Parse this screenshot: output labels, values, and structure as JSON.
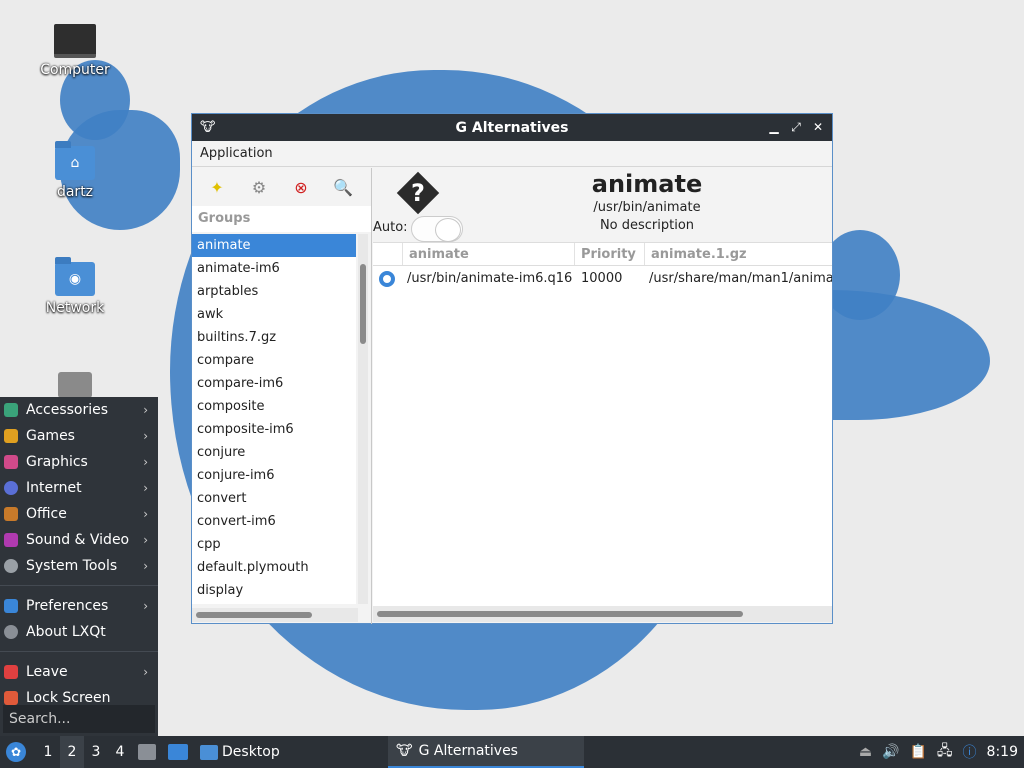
{
  "desktop": {
    "icons": [
      {
        "label": "Computer",
        "icon": "computer-icon"
      },
      {
        "label": "dartz",
        "icon": "home-folder-icon"
      },
      {
        "label": "Network",
        "icon": "network-folder-icon"
      }
    ]
  },
  "window": {
    "title": "G Alternatives",
    "menu": {
      "application": "Application"
    },
    "toolbar": [
      "new-icon",
      "properties-icon",
      "delete-icon",
      "search-icon"
    ],
    "groups_header": "Groups",
    "groups": [
      "animate",
      "animate-im6",
      "arptables",
      "awk",
      "builtins.7.gz",
      "compare",
      "compare-im6",
      "composite",
      "composite-im6",
      "conjure",
      "conjure-im6",
      "convert",
      "convert-im6",
      "cpp",
      "default.plymouth",
      "display"
    ],
    "selected_group": "animate",
    "detail": {
      "name": "animate",
      "path": "/usr/bin/animate",
      "description": "No description",
      "auto_label": "Auto:",
      "auto_enabled": false,
      "columns": [
        "animate",
        "Priority",
        "animate.1.gz"
      ],
      "rows": [
        {
          "selected": true,
          "path": "/usr/bin/animate-im6.q16",
          "priority": "10000",
          "slave": "/usr/share/man/man1/anima"
        }
      ]
    }
  },
  "start_menu": {
    "items": [
      {
        "label": "Accessories",
        "submenu": true,
        "color": "#3aa37a"
      },
      {
        "label": "Games",
        "submenu": true,
        "color": "#e0a020"
      },
      {
        "label": "Graphics",
        "submenu": true,
        "color": "#d04a8a"
      },
      {
        "label": "Internet",
        "submenu": true,
        "color": "#5a6fd6"
      },
      {
        "label": "Office",
        "submenu": true,
        "color": "#c87a2a"
      },
      {
        "label": "Sound & Video",
        "submenu": true,
        "color": "#b03ab0"
      },
      {
        "label": "System Tools",
        "submenu": true,
        "color": "#9aa0a6"
      }
    ],
    "items2": [
      {
        "label": "Preferences",
        "submenu": true,
        "color": "#3a86d8"
      },
      {
        "label": "About LXQt",
        "submenu": false,
        "color": "#8a8f96"
      }
    ],
    "items3": [
      {
        "label": "Leave",
        "submenu": true,
        "color": "#e04040"
      },
      {
        "label": "Lock Screen",
        "submenu": false,
        "color": "#e05a3a"
      }
    ],
    "search_placeholder": "Search..."
  },
  "taskbar": {
    "workspaces": [
      "1",
      "2",
      "3",
      "4"
    ],
    "active_workspace": "2",
    "desktop_label": "Desktop",
    "task_label": "G Alternatives",
    "clock": "8:19"
  }
}
